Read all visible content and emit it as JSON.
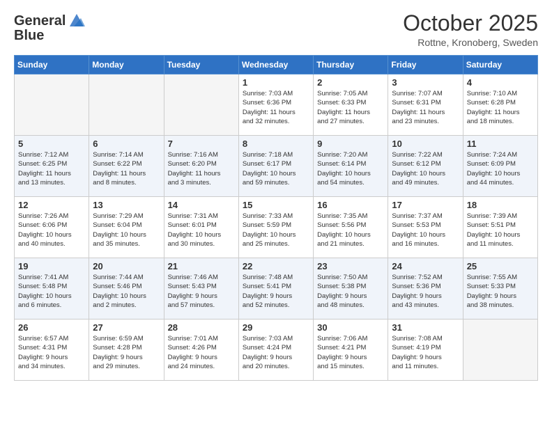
{
  "header": {
    "logo_text_general": "General",
    "logo_text_blue": "Blue",
    "month": "October 2025",
    "location": "Rottne, Kronoberg, Sweden"
  },
  "days_of_week": [
    "Sunday",
    "Monday",
    "Tuesday",
    "Wednesday",
    "Thursday",
    "Friday",
    "Saturday"
  ],
  "weeks": [
    [
      {
        "day": "",
        "info": ""
      },
      {
        "day": "",
        "info": ""
      },
      {
        "day": "",
        "info": ""
      },
      {
        "day": "1",
        "info": "Sunrise: 7:03 AM\nSunset: 6:36 PM\nDaylight: 11 hours\nand 32 minutes."
      },
      {
        "day": "2",
        "info": "Sunrise: 7:05 AM\nSunset: 6:33 PM\nDaylight: 11 hours\nand 27 minutes."
      },
      {
        "day": "3",
        "info": "Sunrise: 7:07 AM\nSunset: 6:31 PM\nDaylight: 11 hours\nand 23 minutes."
      },
      {
        "day": "4",
        "info": "Sunrise: 7:10 AM\nSunset: 6:28 PM\nDaylight: 11 hours\nand 18 minutes."
      }
    ],
    [
      {
        "day": "5",
        "info": "Sunrise: 7:12 AM\nSunset: 6:25 PM\nDaylight: 11 hours\nand 13 minutes."
      },
      {
        "day": "6",
        "info": "Sunrise: 7:14 AM\nSunset: 6:22 PM\nDaylight: 11 hours\nand 8 minutes."
      },
      {
        "day": "7",
        "info": "Sunrise: 7:16 AM\nSunset: 6:20 PM\nDaylight: 11 hours\nand 3 minutes."
      },
      {
        "day": "8",
        "info": "Sunrise: 7:18 AM\nSunset: 6:17 PM\nDaylight: 10 hours\nand 59 minutes."
      },
      {
        "day": "9",
        "info": "Sunrise: 7:20 AM\nSunset: 6:14 PM\nDaylight: 10 hours\nand 54 minutes."
      },
      {
        "day": "10",
        "info": "Sunrise: 7:22 AM\nSunset: 6:12 PM\nDaylight: 10 hours\nand 49 minutes."
      },
      {
        "day": "11",
        "info": "Sunrise: 7:24 AM\nSunset: 6:09 PM\nDaylight: 10 hours\nand 44 minutes."
      }
    ],
    [
      {
        "day": "12",
        "info": "Sunrise: 7:26 AM\nSunset: 6:06 PM\nDaylight: 10 hours\nand 40 minutes."
      },
      {
        "day": "13",
        "info": "Sunrise: 7:29 AM\nSunset: 6:04 PM\nDaylight: 10 hours\nand 35 minutes."
      },
      {
        "day": "14",
        "info": "Sunrise: 7:31 AM\nSunset: 6:01 PM\nDaylight: 10 hours\nand 30 minutes."
      },
      {
        "day": "15",
        "info": "Sunrise: 7:33 AM\nSunset: 5:59 PM\nDaylight: 10 hours\nand 25 minutes."
      },
      {
        "day": "16",
        "info": "Sunrise: 7:35 AM\nSunset: 5:56 PM\nDaylight: 10 hours\nand 21 minutes."
      },
      {
        "day": "17",
        "info": "Sunrise: 7:37 AM\nSunset: 5:53 PM\nDaylight: 10 hours\nand 16 minutes."
      },
      {
        "day": "18",
        "info": "Sunrise: 7:39 AM\nSunset: 5:51 PM\nDaylight: 10 hours\nand 11 minutes."
      }
    ],
    [
      {
        "day": "19",
        "info": "Sunrise: 7:41 AM\nSunset: 5:48 PM\nDaylight: 10 hours\nand 6 minutes."
      },
      {
        "day": "20",
        "info": "Sunrise: 7:44 AM\nSunset: 5:46 PM\nDaylight: 10 hours\nand 2 minutes."
      },
      {
        "day": "21",
        "info": "Sunrise: 7:46 AM\nSunset: 5:43 PM\nDaylight: 9 hours\nand 57 minutes."
      },
      {
        "day": "22",
        "info": "Sunrise: 7:48 AM\nSunset: 5:41 PM\nDaylight: 9 hours\nand 52 minutes."
      },
      {
        "day": "23",
        "info": "Sunrise: 7:50 AM\nSunset: 5:38 PM\nDaylight: 9 hours\nand 48 minutes."
      },
      {
        "day": "24",
        "info": "Sunrise: 7:52 AM\nSunset: 5:36 PM\nDaylight: 9 hours\nand 43 minutes."
      },
      {
        "day": "25",
        "info": "Sunrise: 7:55 AM\nSunset: 5:33 PM\nDaylight: 9 hours\nand 38 minutes."
      }
    ],
    [
      {
        "day": "26",
        "info": "Sunrise: 6:57 AM\nSunset: 4:31 PM\nDaylight: 9 hours\nand 34 minutes."
      },
      {
        "day": "27",
        "info": "Sunrise: 6:59 AM\nSunset: 4:28 PM\nDaylight: 9 hours\nand 29 minutes."
      },
      {
        "day": "28",
        "info": "Sunrise: 7:01 AM\nSunset: 4:26 PM\nDaylight: 9 hours\nand 24 minutes."
      },
      {
        "day": "29",
        "info": "Sunrise: 7:03 AM\nSunset: 4:24 PM\nDaylight: 9 hours\nand 20 minutes."
      },
      {
        "day": "30",
        "info": "Sunrise: 7:06 AM\nSunset: 4:21 PM\nDaylight: 9 hours\nand 15 minutes."
      },
      {
        "day": "31",
        "info": "Sunrise: 7:08 AM\nSunset: 4:19 PM\nDaylight: 9 hours\nand 11 minutes."
      },
      {
        "day": "",
        "info": ""
      }
    ]
  ]
}
